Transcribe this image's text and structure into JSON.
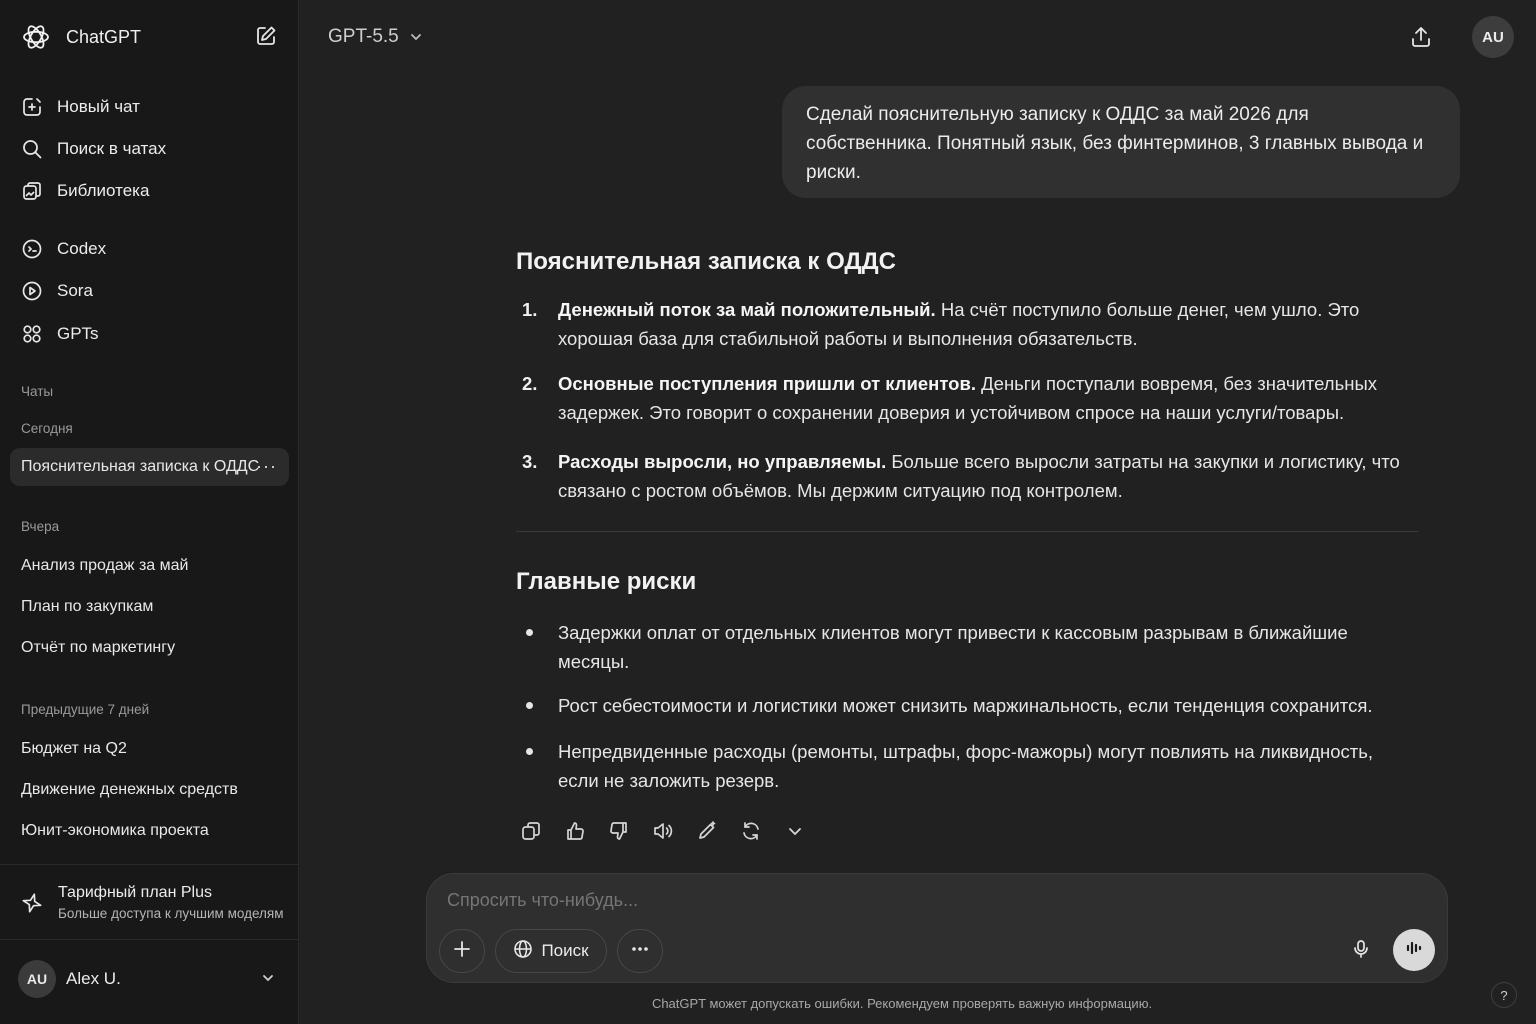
{
  "sidebar": {
    "brand": "ChatGPT",
    "nav": [
      {
        "label": "Новый чат",
        "icon": "new-chat-icon"
      },
      {
        "label": "Поиск в чатах",
        "icon": "search-icon"
      },
      {
        "label": "Библиотека",
        "icon": "library-icon"
      },
      {
        "label": "Codex",
        "icon": "codex-icon"
      },
      {
        "label": "Sora",
        "icon": "sora-play-icon"
      },
      {
        "label": "GPTs",
        "icon": "grid-icon"
      }
    ],
    "chats_label": "Чаты",
    "today_label": "Сегодня",
    "today": [
      {
        "label": "Пояснительная записка к ОДДС",
        "more": "···"
      }
    ],
    "yesterday_label": "Вчера",
    "yesterday": [
      {
        "label": "Анализ продаж за май"
      },
      {
        "label": "План по закупкам"
      },
      {
        "label": "Отчёт по маркетингу"
      }
    ],
    "prev7_label": "Предыдущие 7 дней",
    "prev7": [
      {
        "label": "Бюджет на Q2"
      },
      {
        "label": "Движение денежных средств"
      },
      {
        "label": "Юнит-экономика проекта"
      }
    ],
    "plan": {
      "title": "Тарифный план Plus",
      "subtitle": "Больше доступа к лучшим моделям"
    },
    "user": {
      "initials": "AU",
      "name": "Alex U."
    }
  },
  "header": {
    "model": "GPT-5.5",
    "avatar": "AU"
  },
  "conversation": {
    "user_message": "Сделай пояснительную записку к ОДДС за май 2026 для собственника. Понятный язык, без финтерминов, 3 главных вывода и риски.",
    "answer": {
      "title": "Пояснительная записка к ОДДС",
      "points": [
        {
          "num": "1.",
          "bold": "Денежный поток за май положительный.",
          "text": " На счёт поступило больше денег, чем ушло. Это хорошая база для стабильной работы и выполнения обязательств."
        },
        {
          "num": "2.",
          "bold": "Основные поступления пришли от клиентов.",
          "text": " Деньги поступали вовремя, без значительных задержек. Это говорит о сохранении доверия и устойчивом спросе на наши услуги/товары."
        },
        {
          "num": "3.",
          "bold": "Расходы выросли, но управляемы.",
          "text": " Больше всего выросли затраты на закупки и логистику, что связано с ростом объёмов. Мы держим ситуацию под контролем."
        }
      ],
      "risks_title": "Главные риски",
      "risks": [
        "Задержки оплат от отдельных клиентов могут привести к кассовым разрывам в ближайшие месяцы.",
        "Рост себестоимости и логистики может снизить маржинальность, если тенденция сохранится.",
        "Непредвиденные расходы (ремонты, штрафы, форс-мажоры) могут повлиять на ликвидность, если не заложить резерв."
      ]
    }
  },
  "composer": {
    "placeholder": "Спросить что-нибудь...",
    "search_label": "Поиск"
  },
  "footer": {
    "disclaimer": "ChatGPT может допускать ошибки. Рекомендуем проверять важную информацию.",
    "help": "?"
  }
}
